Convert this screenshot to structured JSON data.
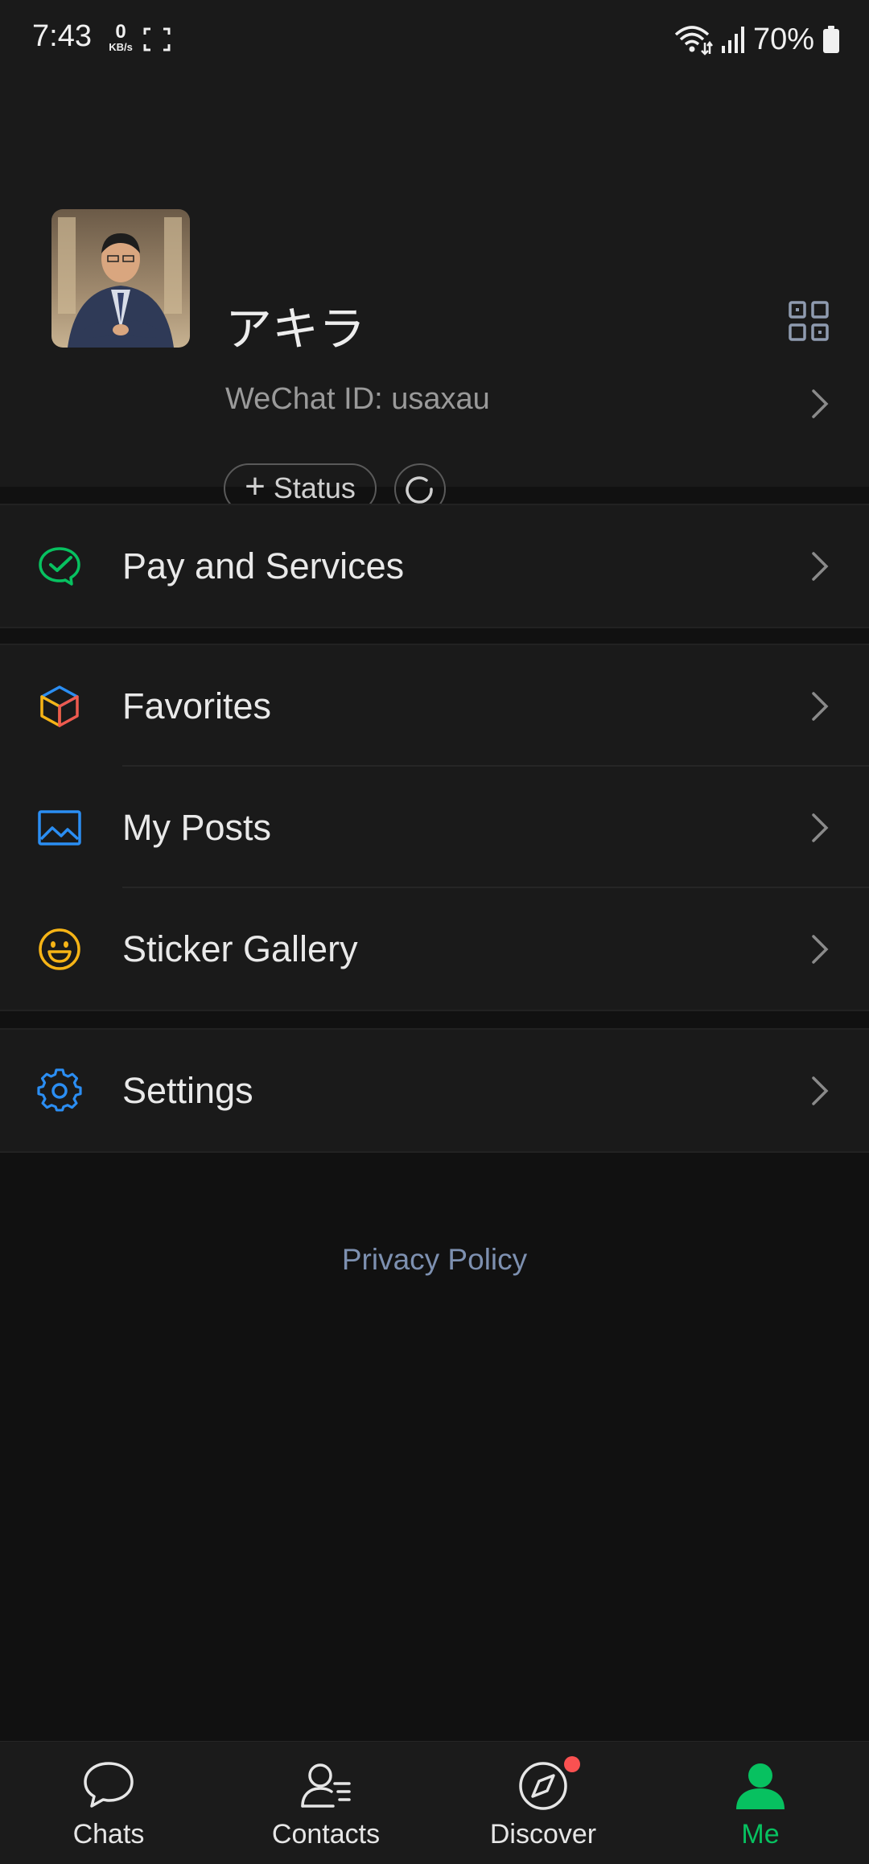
{
  "status_bar": {
    "time": "7:43",
    "net_speed_value": "0",
    "net_speed_unit": "KB/s",
    "battery_percent": "70%"
  },
  "profile": {
    "name": "アキラ",
    "wechat_id": "WeChat ID: usaxau",
    "status_label": "Status"
  },
  "menu": {
    "pay": "Pay and Services",
    "favorites": "Favorites",
    "my_posts": "My Posts",
    "sticker_gallery": "Sticker Gallery",
    "settings": "Settings"
  },
  "privacy_policy": "Privacy Policy",
  "tabs": [
    {
      "label": "Chats",
      "icon": "chat-bubble-icon",
      "active": false
    },
    {
      "label": "Contacts",
      "icon": "contacts-icon",
      "active": false
    },
    {
      "label": "Discover",
      "icon": "compass-icon",
      "active": false,
      "badge": true
    },
    {
      "label": "Me",
      "icon": "person-icon",
      "active": true
    }
  ],
  "colors": {
    "accent_green": "#07c160",
    "badge_red": "#fa5151",
    "link_blue": "#7d90b0"
  }
}
